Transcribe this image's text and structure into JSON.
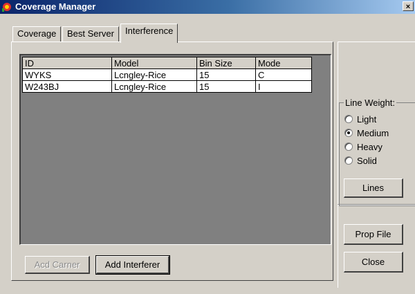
{
  "window": {
    "title": "Coverage Manager",
    "close_label": "×"
  },
  "tabs": [
    {
      "label": "Coverage",
      "active": false
    },
    {
      "label": "Best Server",
      "active": false
    },
    {
      "label": "Interference",
      "active": true
    }
  ],
  "table": {
    "columns": [
      "ID",
      "Model",
      "Bin Size",
      "Mode"
    ],
    "rows": [
      [
        "WYKS",
        "Lcngley-Rice",
        "15",
        "C"
      ],
      [
        "W243BJ",
        "Lcngley-Rice",
        "15",
        "I"
      ]
    ]
  },
  "buttons": {
    "add_carrier": "Acd Carner",
    "add_interferer": "Add Interferer",
    "lines": "Lines",
    "prop_file": "Prop File",
    "close": "Close"
  },
  "line_weight": {
    "label": "Line Weight:",
    "options": [
      {
        "label": "Light",
        "checked": false
      },
      {
        "label": "Medium",
        "checked": true
      },
      {
        "label": "Heavy",
        "checked": false
      },
      {
        "label": "Solid",
        "checked": false
      }
    ]
  },
  "colors": {
    "title_start": "#0a246a",
    "title_end": "#a6caf0",
    "face": "#d4d0c8",
    "grid_bg": "#808080"
  }
}
